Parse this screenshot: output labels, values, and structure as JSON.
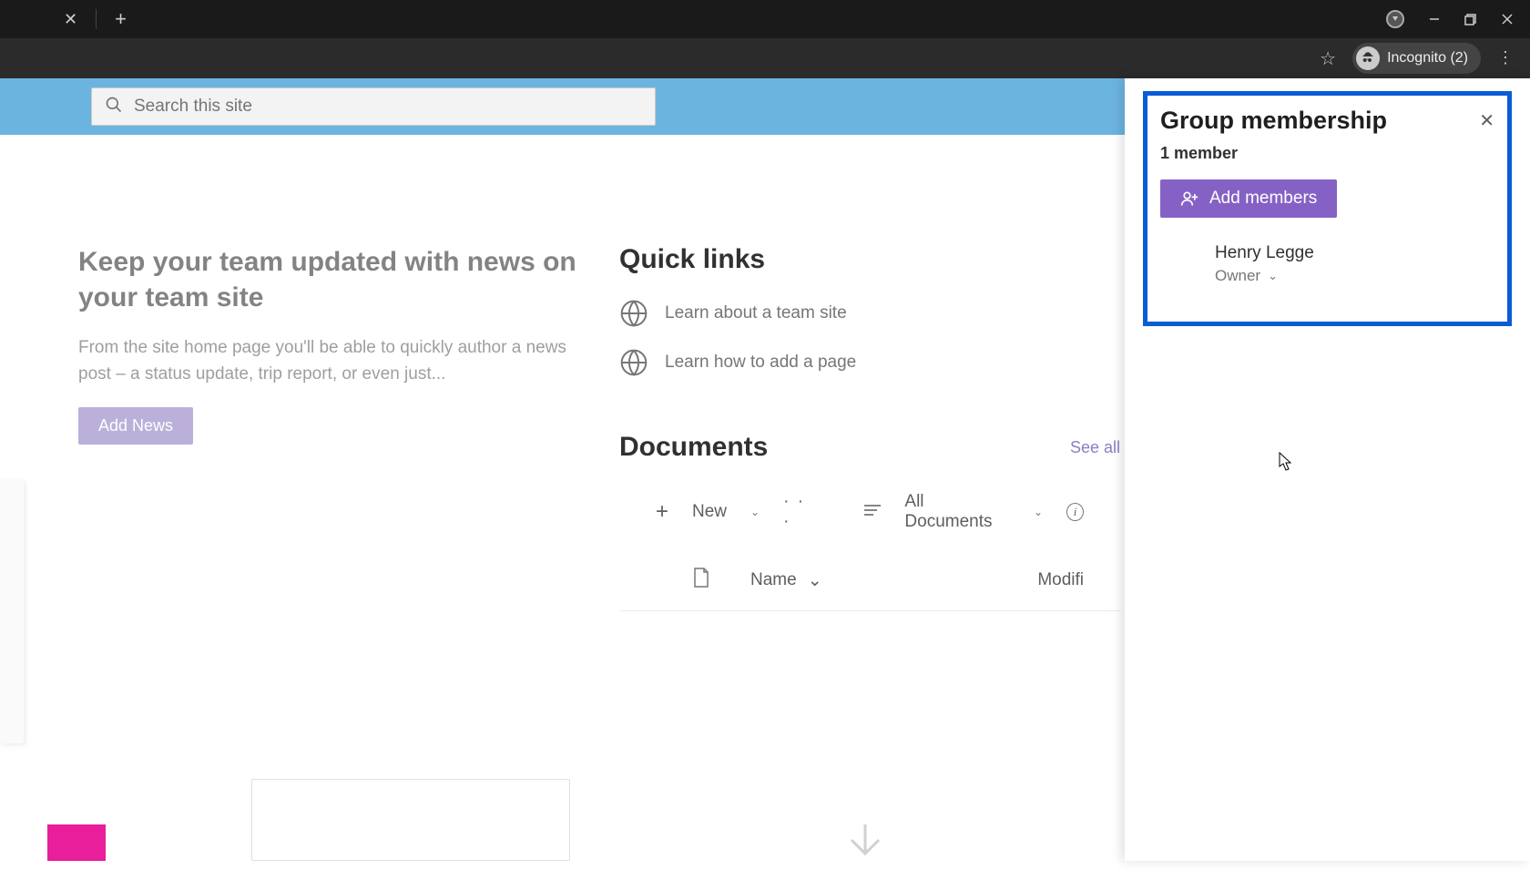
{
  "browser": {
    "incognito_label": "Incognito (2)"
  },
  "search": {
    "placeholder": "Search this site"
  },
  "news": {
    "heading": "Keep your team updated with news on your team site",
    "description": "From the site home page you'll be able to quickly author a news post – a status update, trip report, or even just...",
    "add_button": "Add News"
  },
  "quick_links": {
    "title": "Quick links",
    "items": [
      {
        "label": "Learn about a team site"
      },
      {
        "label": "Learn how to add a page"
      }
    ]
  },
  "documents": {
    "title": "Documents",
    "see_all": "See all",
    "new_label": "New",
    "view_label": "All Documents",
    "columns": {
      "name": "Name",
      "modified": "Modifi"
    }
  },
  "panel": {
    "title": "Group membership",
    "member_count": "1 member",
    "add_button": "Add members",
    "members": [
      {
        "name": "Henry Legge",
        "role": "Owner"
      }
    ]
  }
}
